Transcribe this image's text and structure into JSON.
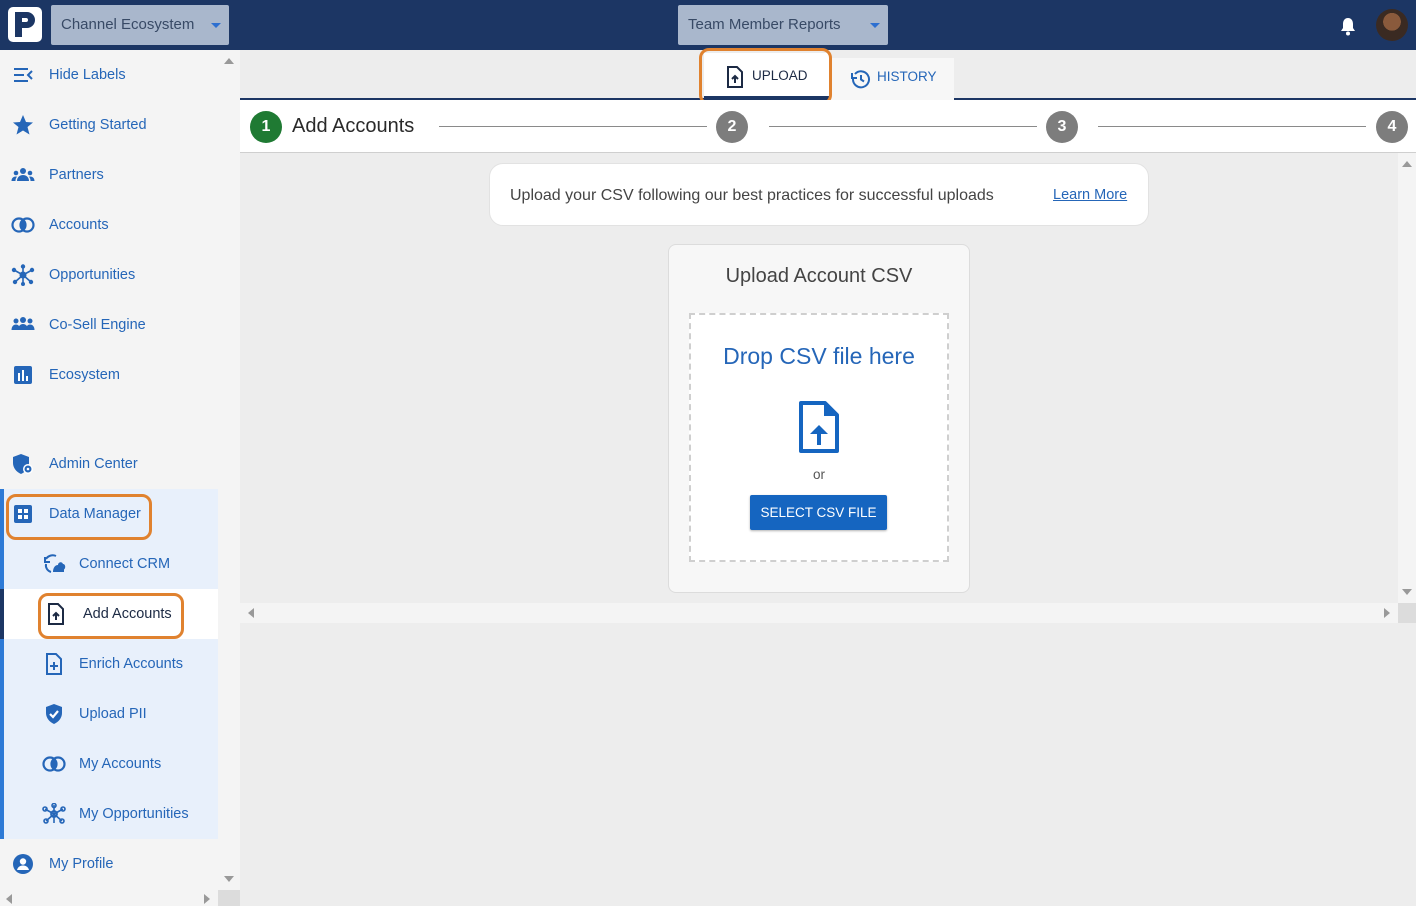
{
  "topbar": {
    "workspace_dropdown": "Channel Ecosystem",
    "report_dropdown": "Team Member Reports"
  },
  "sidebar": {
    "items": [
      {
        "label": "Hide Labels",
        "icon": "hide-labels-icon"
      },
      {
        "label": "Getting Started",
        "icon": "star-icon"
      },
      {
        "label": "Partners",
        "icon": "partners-icon"
      },
      {
        "label": "Accounts",
        "icon": "accounts-icon"
      },
      {
        "label": "Opportunities",
        "icon": "opportunities-icon"
      },
      {
        "label": "Co-Sell Engine",
        "icon": "co-sell-icon"
      },
      {
        "label": "Ecosystem",
        "icon": "bar-chart-icon"
      },
      {
        "label": "Admin Center",
        "icon": "shield-gear-icon"
      },
      {
        "label": "Data Manager",
        "icon": "grid-icon"
      },
      {
        "label": "Connect CRM",
        "icon": "connect-crm-icon"
      },
      {
        "label": "Add Accounts",
        "icon": "file-upload-icon"
      },
      {
        "label": "Enrich Accounts",
        "icon": "file-plus-icon"
      },
      {
        "label": "Upload PII",
        "icon": "shield-check-icon"
      },
      {
        "label": "My Accounts",
        "icon": "accounts-icon"
      },
      {
        "label": "My Opportunities",
        "icon": "opportunities-icon"
      },
      {
        "label": "My Profile",
        "icon": "user-circle-icon"
      }
    ]
  },
  "tabs": {
    "upload": "UPLOAD",
    "history": "HISTORY"
  },
  "stepper": {
    "step1_number": "1",
    "step1_title": "Add Accounts",
    "step2_number": "2",
    "step3_number": "3",
    "step4_number": "4"
  },
  "info": {
    "text": "Upload your CSV following our best practices for successful uploads",
    "link": "Learn More"
  },
  "upload_card": {
    "title": "Upload Account CSV",
    "drop_text": "Drop CSV file here",
    "or": "or",
    "button": "SELECT CSV FILE"
  },
  "colors": {
    "topbar": "#1c3664",
    "accent": "#2566b8",
    "step_active": "#1f7a33",
    "highlight": "#e0822f"
  }
}
